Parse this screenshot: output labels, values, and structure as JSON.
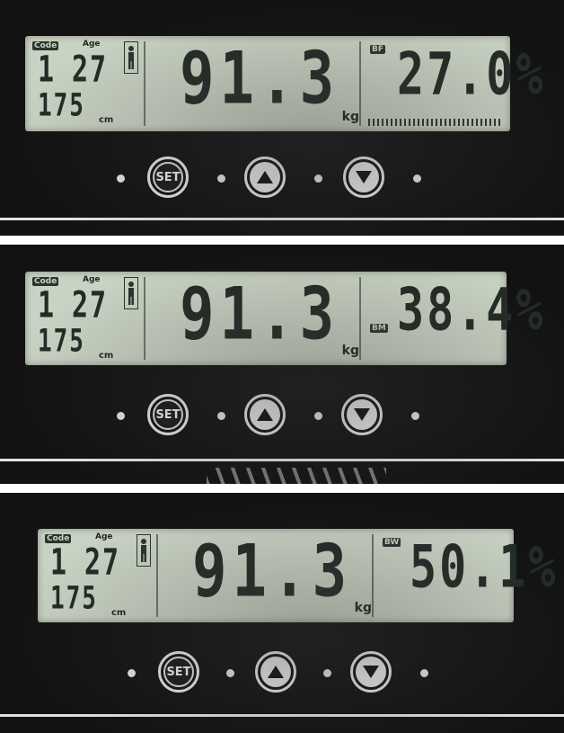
{
  "panels": [
    {
      "code_tag": "Code",
      "age_tag": "Age",
      "code": "1",
      "age": "27",
      "height": "175",
      "height_unit": "cm",
      "weight": "91.3",
      "weight_unit": "kg",
      "metric_tag": "BF",
      "metric_value": "27.0%",
      "set_label": "SET"
    },
    {
      "code_tag": "Code",
      "age_tag": "Age",
      "code": "1",
      "age": "27",
      "height": "175",
      "height_unit": "cm",
      "weight": "91.3",
      "weight_unit": "kg",
      "metric_tag": "BM",
      "metric_value": "38.4%",
      "set_label": "SET"
    },
    {
      "code_tag": "Code",
      "age_tag": "Age",
      "code": "1",
      "age": "27",
      "height": "175",
      "height_unit": "cm",
      "weight": "91.3",
      "weight_unit": "kg",
      "metric_tag": "BW",
      "metric_value": "50.1%",
      "set_label": "SET"
    }
  ],
  "icons": {
    "person": "person-icon",
    "up": "arrow-up-icon",
    "down": "arrow-down-icon"
  },
  "colors": {
    "lcd_background": "#c9d3c3",
    "lcd_segments": "#232b25",
    "device_body": "#121212"
  }
}
